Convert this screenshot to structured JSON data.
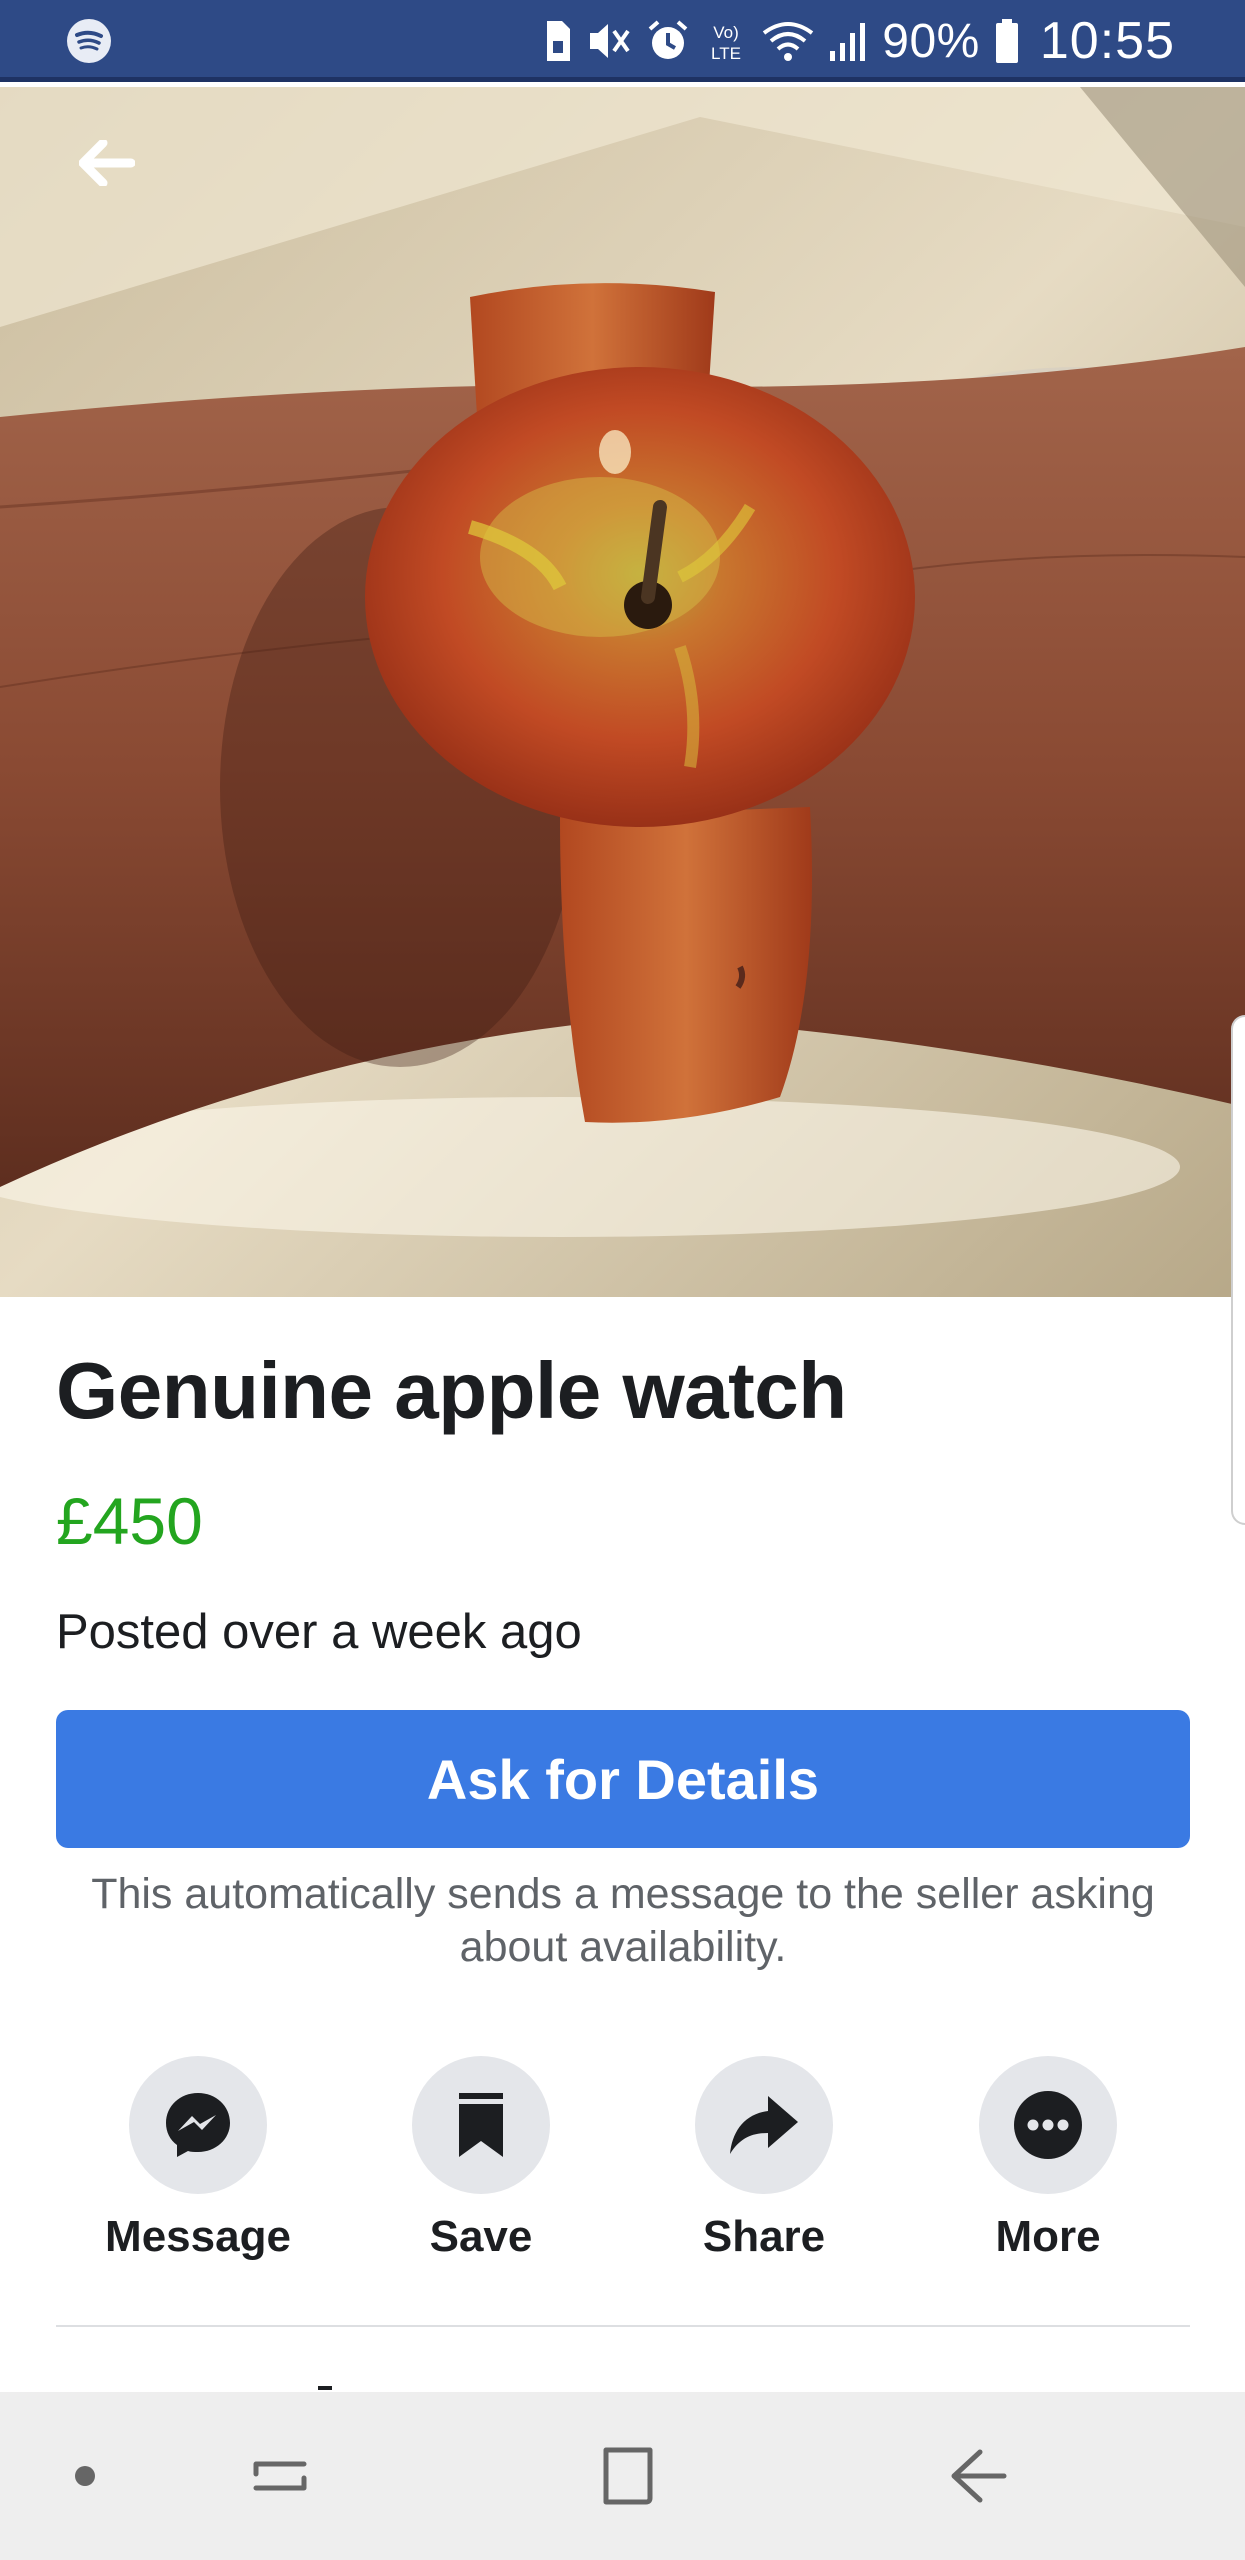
{
  "status_bar": {
    "battery": "90%",
    "time": "10:55",
    "network": "LTE",
    "icons": [
      "spotify-icon",
      "sim-icon",
      "mute-icon",
      "alarm-icon",
      "volte-icon",
      "wifi-icon",
      "signal-icon",
      "battery-icon"
    ]
  },
  "listing": {
    "title": "Genuine apple watch",
    "price": "£450",
    "posted": "Posted over a week ago",
    "ask_button": "Ask for Details",
    "ask_note": "This automatically sends a message to the seller asking about availability."
  },
  "actions": [
    {
      "label": "Message",
      "icon": "messenger-icon"
    },
    {
      "label": "Save",
      "icon": "bookmark-icon"
    },
    {
      "label": "Share",
      "icon": "share-arrow-icon"
    },
    {
      "label": "More",
      "icon": "more-dots-icon"
    }
  ],
  "colors": {
    "status_bar": "#2e4a86",
    "accent": "#3a7ae3",
    "price": "#23a51f",
    "action_circle": "#e4e6ea"
  },
  "nav_bar": {
    "icons": [
      "dot-icon",
      "recents-icon",
      "home-icon",
      "back-icon"
    ]
  }
}
